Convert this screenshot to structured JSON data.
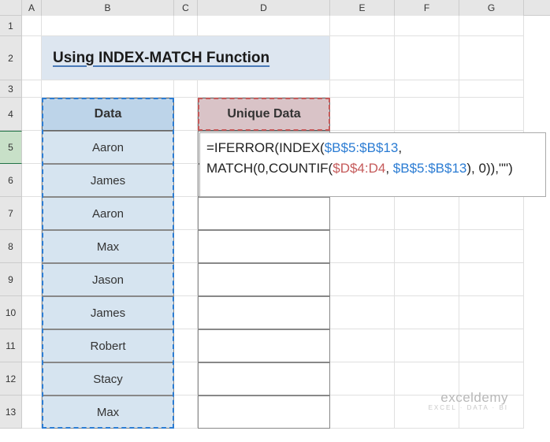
{
  "columns": [
    "A",
    "B",
    "C",
    "D",
    "E",
    "F",
    "G"
  ],
  "rows": [
    "1",
    "2",
    "3",
    "4",
    "5",
    "6",
    "7",
    "8",
    "9",
    "10",
    "11",
    "12",
    "13"
  ],
  "title": "Using INDEX-MATCH Function",
  "headers": {
    "data": "Data",
    "unique": "Unique Data"
  },
  "data_values": [
    "Aaron",
    "James",
    "Aaron",
    "Max",
    "Jason",
    "James",
    "Robert",
    "Stacy",
    "Max"
  ],
  "formula": {
    "prefix": "=IFERROR(INDEX(",
    "range1": "$B$5:$B$13",
    "mid1": ",",
    "line2_prefix": "MATCH(0,COUNTIF(",
    "range2": "$D$4:D4",
    "mid2": ", ",
    "range3": "$B$5:$B$13",
    "suffix": "), 0)),\"\")"
  },
  "watermark": {
    "main": "exceldemy",
    "sub": "EXCEL · DATA · BI"
  },
  "chart_data": {
    "type": "table",
    "title": "Using INDEX-MATCH Function",
    "columns": [
      "Data",
      "Unique Data"
    ],
    "rows": [
      [
        "Aaron",
        "=IFERROR(INDEX($B$5:$B$13, MATCH(0,COUNTIF($D$4:D4, $B$5:$B$13), 0)),\"\")"
      ],
      [
        "James",
        ""
      ],
      [
        "Aaron",
        ""
      ],
      [
        "Max",
        ""
      ],
      [
        "Jason",
        ""
      ],
      [
        "James",
        ""
      ],
      [
        "Robert",
        ""
      ],
      [
        "Stacy",
        ""
      ],
      [
        "Max",
        ""
      ]
    ]
  }
}
